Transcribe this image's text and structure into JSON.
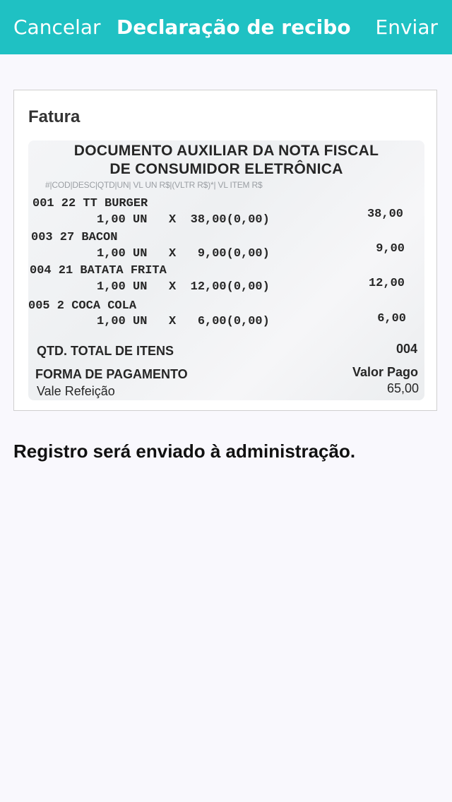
{
  "navbar": {
    "cancel_label": "Cancelar",
    "title": "Declaração de recibo",
    "send_label": "Enviar",
    "accent_color": "#1fc1c3"
  },
  "card": {
    "title": "Fatura",
    "receipt": {
      "header_line1": "DOCUMENTO AUXILIAR DA NOTA FISCAL",
      "header_line2": "DE CONSUMIDOR ELETRÔNICA",
      "columns": "#|COD|DESC|QTD|UN| VL UN R$|(VLTR R$)*| VL ITEM R$",
      "items": [
        {
          "line": "001 22 TT BURGER",
          "detail": "1,00 UN   X  38,00(0,00)",
          "total": "38,00"
        },
        {
          "line": "003 27 BACON",
          "detail": "1,00 UN   X   9,00(0,00)",
          "total": "9,00"
        },
        {
          "line": "004 21 BATATA FRITA",
          "detail": "1,00 UN   X  12,00(0,00)",
          "total": "12,00"
        },
        {
          "line": "005 2 COCA COLA",
          "detail": "1,00 UN   X   6,00(0,00)",
          "total": "6,00"
        }
      ],
      "qty_label": "QTD. TOTAL DE ITENS",
      "qty_value": "004",
      "payment_label": "FORMA DE PAGAMENTO",
      "paid_label": "Valor Pago",
      "payment_method": "Vale Refeição",
      "paid_value": "65,00"
    }
  },
  "message": "Registro será enviado à administração."
}
